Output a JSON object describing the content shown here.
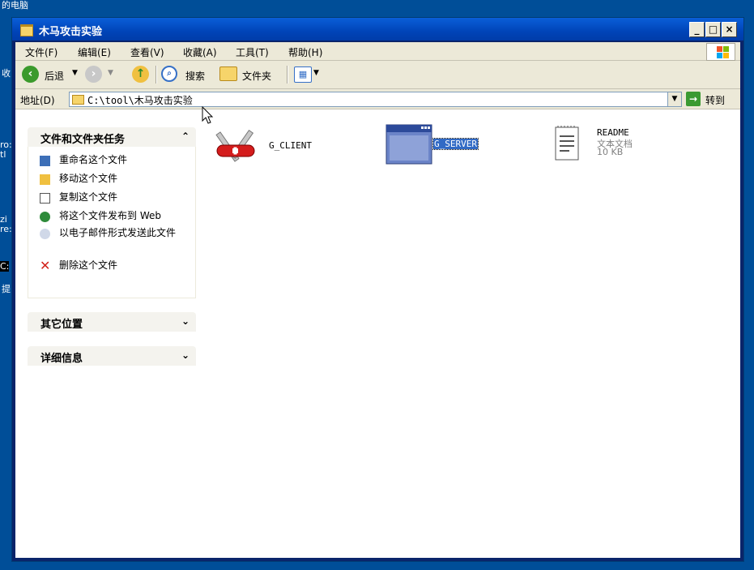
{
  "desktop": {
    "top_label": "的电脑",
    "left_frags": [
      "收",
      "ro:",
      "tl",
      "zi",
      "re:",
      "C:",
      "提"
    ]
  },
  "window": {
    "title": "木马攻击实验",
    "buttons": {
      "minimize": "_",
      "maximize": "□",
      "close": "×"
    }
  },
  "menu": [
    {
      "label": "文件(F)"
    },
    {
      "label": "编辑(E)"
    },
    {
      "label": "查看(V)"
    },
    {
      "label": "收藏(A)"
    },
    {
      "label": "工具(T)"
    },
    {
      "label": "帮助(H)"
    }
  ],
  "toolbar": {
    "back_label": "后退",
    "search_label": "搜索",
    "folders_label": "文件夹"
  },
  "address": {
    "label": "地址(D)",
    "path": "C:\\tool\\木马攻击实验",
    "go_label": "转到"
  },
  "taskpane": {
    "file_tasks": {
      "title": "文件和文件夹任务",
      "items": [
        "重命名这个文件",
        "移动这个文件",
        "复制这个文件",
        "将这个文件发布到 Web",
        "以电子邮件形式发送此文件",
        "删除这个文件"
      ]
    },
    "other_places": {
      "title": "其它位置"
    },
    "details": {
      "title": "详细信息"
    }
  },
  "files": [
    {
      "name": "G_CLIENT"
    },
    {
      "name": "G_SERVER"
    },
    {
      "name": "README",
      "type": "文本文档",
      "size": "10 KB"
    }
  ],
  "colors": {
    "title_bar": "#0a5fd8",
    "selection": "#316ac5",
    "desktop": "#004e98"
  }
}
